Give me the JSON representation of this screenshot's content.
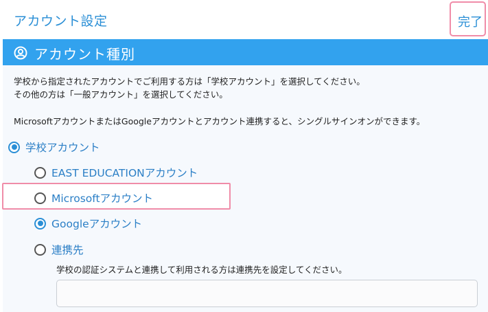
{
  "header": {
    "title": "アカウント設定",
    "done_label": "完了"
  },
  "section": {
    "icon": "user-circle-icon",
    "title": "アカウント種別"
  },
  "description": {
    "line1": "学校から指定されたアカウントでご利用する方は「学校アカウント」を選択してください。",
    "line2": "その他の方は「一般アカウント」を選択してください。",
    "line3": "MicrosoftアカウントまたはGoogleアカウントとアカウント連携すると、シングルサインオンができます。"
  },
  "options": {
    "school_account": {
      "label": "学校アカウント",
      "selected": true
    },
    "east_education": {
      "label": "EAST EDUCATIONアカウント",
      "selected": false
    },
    "microsoft": {
      "label": "Microsoftアカウント",
      "selected": false
    },
    "google": {
      "label": "Googleアカウント",
      "selected": true
    },
    "renkeisaki": {
      "label": "連携先",
      "selected": false
    }
  },
  "renkeisaki_desc": "学校の認証システムと連携して利用される方は連携先を設定してください。",
  "renkeisaki_input": {
    "value": "",
    "placeholder": ""
  },
  "colors": {
    "accent": "#2b8fd6",
    "header_bar": "#32a2ee",
    "highlight": "#f08ca8"
  }
}
